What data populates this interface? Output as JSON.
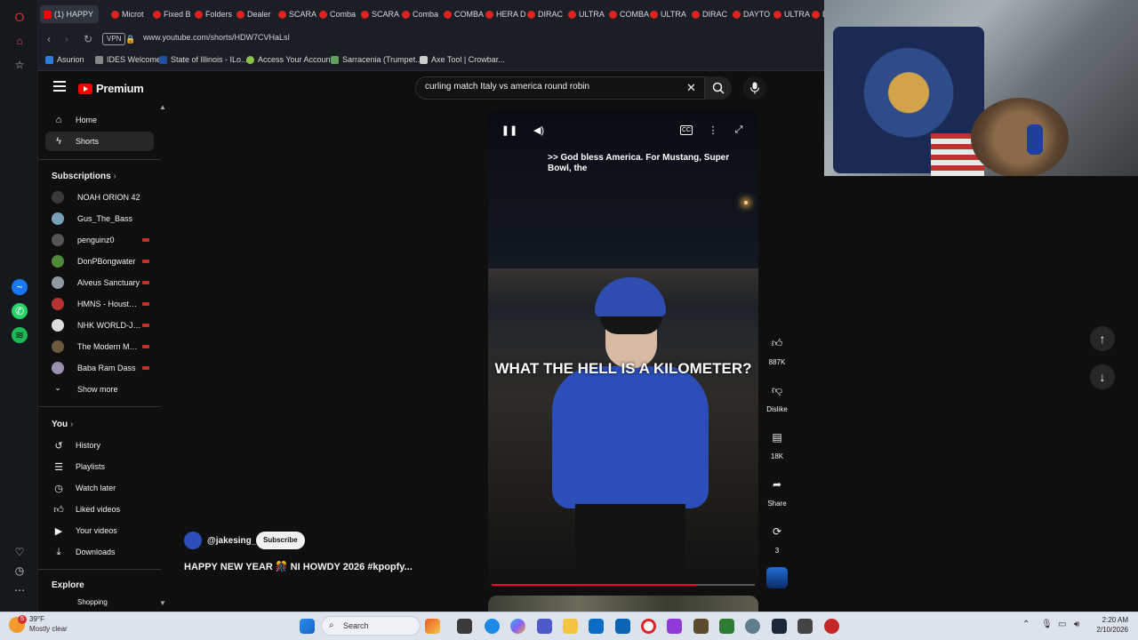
{
  "browser": {
    "tabs": [
      {
        "label": "(1) HAPPY",
        "active": true
      },
      {
        "label": "Microt"
      },
      {
        "label": "Fixed B"
      },
      {
        "label": "Folders"
      },
      {
        "label": "Dealer"
      },
      {
        "label": "SCARA"
      },
      {
        "label": "Comba"
      },
      {
        "label": "SCARA"
      },
      {
        "label": "Comba"
      },
      {
        "label": "COMBA"
      },
      {
        "label": "HERA D"
      },
      {
        "label": "DIRAC"
      },
      {
        "label": "ULTRA"
      },
      {
        "label": "COMBA"
      },
      {
        "label": "ULTRA"
      },
      {
        "label": "DIRAC"
      },
      {
        "label": "DAYTO"
      },
      {
        "label": "ULTRA"
      },
      {
        "label": "Di"
      }
    ],
    "vpn_label": "VPN",
    "url": "www.youtube.com/shorts/HDW7CVHaLsI",
    "bookmarks": [
      {
        "label": "Asurion",
        "color": "#2f7de1"
      },
      {
        "label": "IDES Welcome",
        "color": "#888888"
      },
      {
        "label": "State of Illinois - ILo...",
        "color": "#1f4fa3"
      },
      {
        "label": "Access Your Account",
        "color": "#8bc34a"
      },
      {
        "label": "Sarracenia (Trumpet...",
        "color": "#5fa35f"
      },
      {
        "label": "Axe Tool | Crowbar...",
        "color": "#cccccc"
      }
    ]
  },
  "youtube": {
    "logo_text": "Premium",
    "search": {
      "query": "curling match Italy vs america round robin"
    },
    "nav": [
      {
        "label": "Home",
        "icon": "home-icon"
      },
      {
        "label": "Shorts",
        "icon": "shorts-icon",
        "selected": true
      }
    ],
    "subscriptions_title": "Subscriptions",
    "subscriptions": [
      {
        "name": "NOAH ORION 42",
        "color": "#3a3a3a",
        "live": false
      },
      {
        "name": "Gus_The_Bass",
        "color": "#7aa0b8",
        "live": false
      },
      {
        "name": "penguinz0",
        "color": "#555555",
        "live": true
      },
      {
        "name": "DonPBongwater",
        "color": "#4f8b3a",
        "live": true
      },
      {
        "name": "Alveus Sanctuary",
        "color": "#8f9aa5",
        "live": true
      },
      {
        "name": "HMNS - Houston...",
        "color": "#b53333",
        "live": true
      },
      {
        "name": "NHK WORLD-JA...",
        "color": "#dddddd",
        "live": true
      },
      {
        "name": "The Modern Mar...",
        "color": "#6b5a3e",
        "live": true
      },
      {
        "name": "Baba Ram Dass",
        "color": "#9a8fb0",
        "live": true
      }
    ],
    "show_more": "Show more",
    "you_title": "You",
    "you_items": [
      {
        "label": "History",
        "icon": "history-icon"
      },
      {
        "label": "Playlists",
        "icon": "playlists-icon"
      },
      {
        "label": "Watch later",
        "icon": "watch-later-icon"
      },
      {
        "label": "Liked videos",
        "icon": "like-icon"
      },
      {
        "label": "Your videos",
        "icon": "your-videos-icon"
      },
      {
        "label": "Downloads",
        "icon": "download-icon"
      }
    ],
    "explore_title": "Explore",
    "explore_partial": "Shopping",
    "video": {
      "caption_top": ">> God bless America. For Mustang, Super Bowl, the",
      "caption_big": "WHAT THE HELL IS A KILOMETER?",
      "progress": 0.78,
      "channel": "@jakesing_",
      "subscribe": "Subscribe",
      "title": "HAPPY NEW YEAR 🎊 NI HOWDY 2026 #kpopfy..."
    },
    "actions": {
      "likes": "887K",
      "dislike": "Dislike",
      "comments": "18K",
      "share": "Share",
      "remix": "3"
    }
  },
  "taskbar": {
    "weather_temp": "39°F",
    "weather_desc": "Mostly clear",
    "search": "Search",
    "time": "2:20 AM",
    "date": "2/10/2026",
    "badge": "5"
  },
  "colors": {
    "yt_red": "#ff0000",
    "accent_progress": "#ff0033",
    "live_indicator": "#c4302b"
  }
}
